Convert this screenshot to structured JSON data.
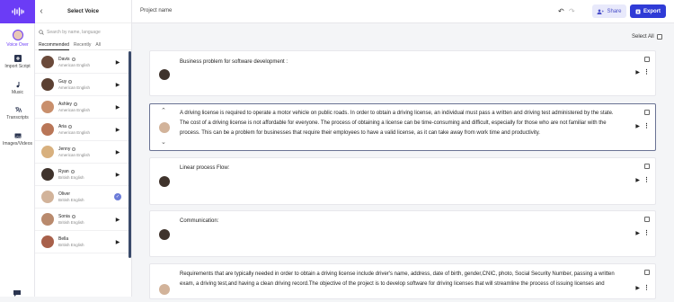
{
  "rail": {
    "items": [
      {
        "label": "Voice Over",
        "icon": "avatar-icon"
      },
      {
        "label": "Import Script",
        "icon": "plus-icon"
      },
      {
        "label": "Music",
        "icon": "music-note-icon"
      },
      {
        "label": "Transcripts",
        "icon": "translate-icon"
      },
      {
        "label": "Images/Videos",
        "icon": "image-icon"
      }
    ]
  },
  "panel": {
    "title": "Select Voice",
    "search_placeholder": "Search by name, language",
    "tabs": [
      "Recommended",
      "Recently",
      "All"
    ],
    "voices": [
      {
        "name": "Davis",
        "lang": "American English",
        "color": "#6b4a3a"
      },
      {
        "name": "Guy",
        "lang": "American English",
        "color": "#5b4032"
      },
      {
        "name": "Ashley",
        "lang": "American English",
        "color": "#c98f6c"
      },
      {
        "name": "Aria",
        "lang": "American English",
        "color": "#b97657"
      },
      {
        "name": "Jenny",
        "lang": "American English",
        "color": "#d8b07e"
      },
      {
        "name": "Ryan",
        "lang": "British English",
        "color": "#3f332c"
      },
      {
        "name": "Oliver",
        "lang": "British English",
        "color": "#d2b39a"
      },
      {
        "name": "Sonia",
        "lang": "British English",
        "color": "#b98a6d"
      },
      {
        "name": "Bella",
        "lang": "British English",
        "color": "#a8604a"
      }
    ]
  },
  "topbar": {
    "project_name": "Project name",
    "share_label": "Share",
    "export_label": "Export"
  },
  "main": {
    "select_all_label": "Select All",
    "cards": [
      {
        "text": "Business problem for software development :"
      },
      {
        "text": "A driving license is required to operate a motor vehicle on public roads. In order to obtain a driving license, an individual must pass a written and driving test administered by the state. The cost of a driving license is not affordable for everyone. The process of obtaining a license can be time-consuming and difficult, especially for those who are not familiar with the process. This can be a problem for businesses that require their employees to have a valid license, as it can take away from work time and productivity."
      },
      {
        "text": "Linear process Flow:"
      },
      {
        "text": "Communication:"
      },
      {
        "text": "Requirements that are typically needed in order to obtain a driving license include driver's name, address, date of birth, gender,CNIC, photo, Social Security Number, passing a written exam, a driving test,and having a clean driving record.The objective of the project is to develop software for driving licenses that will streamline the process of issuing licenses and"
      }
    ]
  }
}
